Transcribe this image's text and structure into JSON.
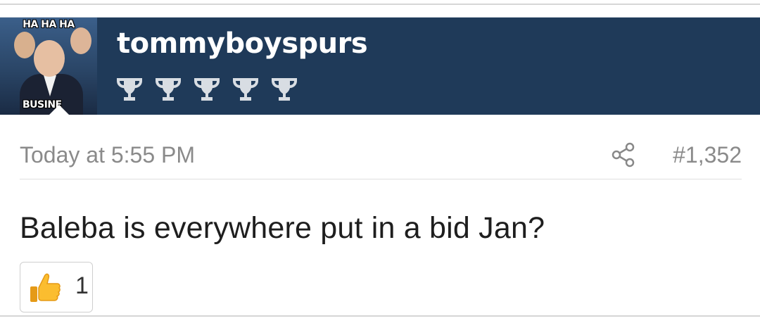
{
  "post": {
    "user": {
      "username": "tommyboyspurs",
      "avatar_caption_top": "HA HA HA",
      "avatar_caption_bottom": "BUSINE",
      "trophy_count": 5,
      "trophy_icon": "trophy-icon",
      "header_color": "#1f3a59"
    },
    "meta": {
      "timestamp": "Today at 5:55 PM",
      "share_icon": "share-icon",
      "post_number": "#1,352"
    },
    "message": "Baleba is everywhere put in a bid Jan?",
    "reaction": {
      "icon": "thumbs-up-icon",
      "count": "1"
    }
  }
}
